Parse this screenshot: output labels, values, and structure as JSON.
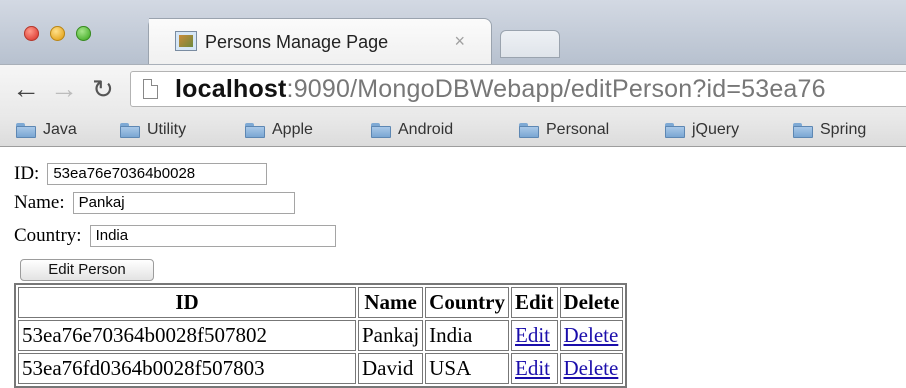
{
  "browser": {
    "tab": {
      "title": "Persons Manage Page",
      "close_glyph": "×"
    },
    "address": {
      "host": "localhost",
      "rest": ":9090/MongoDBWebapp/editPerson?id=53ea76"
    },
    "bookmarks": [
      "Java",
      "Utility",
      "Apple",
      "Android",
      "Personal",
      "jQuery",
      "Spring"
    ]
  },
  "form": {
    "id_label": "ID:",
    "id_value": "53ea76e70364b0028",
    "name_label": "Name:",
    "name_value": "Pankaj",
    "country_label": "Country:",
    "country_value": "India",
    "submit_label": "Edit Person"
  },
  "table": {
    "headers": [
      "ID",
      "Name",
      "Country",
      "Edit",
      "Delete"
    ],
    "rows": [
      {
        "id": "53ea76e70364b0028f507802",
        "name": "Pankaj",
        "country": "India",
        "edit": "Edit",
        "delete": "Delete"
      },
      {
        "id": "53ea76fd0364b0028f507803",
        "name": "David",
        "country": "USA",
        "edit": "Edit",
        "delete": "Delete"
      }
    ]
  },
  "icons": {
    "traffic_lights": [
      "close-icon",
      "minimize-icon",
      "maximize-icon"
    ],
    "nav": [
      "back-arrow-icon",
      "forward-arrow-icon",
      "reload-icon",
      "page-icon"
    ],
    "folder": "folder-icon"
  },
  "colors": {
    "link": "#1a0dab",
    "close": "#e0443a",
    "minimize": "#e6a824",
    "maximize": "#4eb332"
  }
}
